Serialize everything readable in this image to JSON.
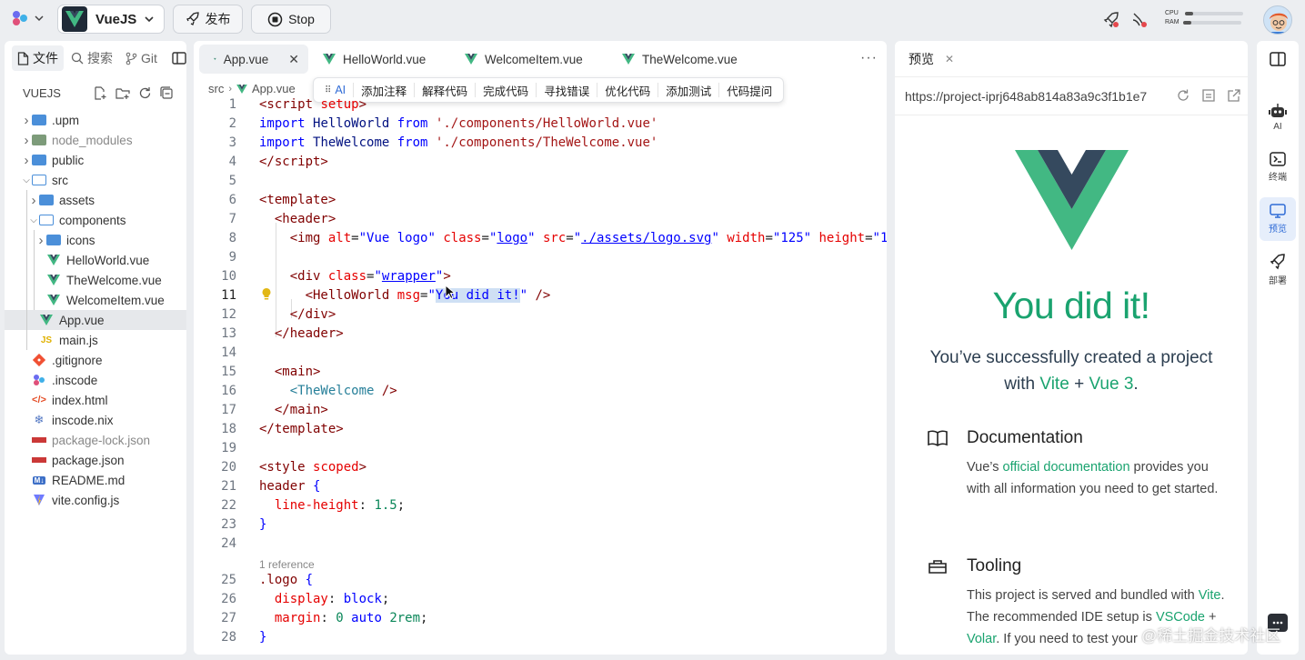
{
  "topbar": {
    "project_name": "VueJS",
    "publish_label": "发布",
    "stop_label": "Stop",
    "cpu_label": "CPU",
    "ram_label": "RAM",
    "cpu_usage": 0.14,
    "ram_usage": 0.14
  },
  "explorer": {
    "tabs": [
      "文件",
      "搜索",
      "Git"
    ],
    "root": "VUEJS",
    "items": [
      {
        "name": ".upm",
        "type": "folder"
      },
      {
        "name": "node_modules",
        "type": "folder-dim"
      },
      {
        "name": "public",
        "type": "folder"
      },
      {
        "name": "src",
        "type": "folder-open"
      },
      {
        "name": "assets",
        "type": "folder"
      },
      {
        "name": "components",
        "type": "folder-open"
      },
      {
        "name": "icons",
        "type": "folder"
      },
      {
        "name": "HelloWorld.vue",
        "type": "vue"
      },
      {
        "name": "TheWelcome.vue",
        "type": "vue"
      },
      {
        "name": "WelcomeItem.vue",
        "type": "vue"
      },
      {
        "name": "App.vue",
        "type": "vue"
      },
      {
        "name": "main.js",
        "type": "js"
      },
      {
        "name": ".gitignore",
        "type": "git"
      },
      {
        "name": ".inscode",
        "type": "inscode"
      },
      {
        "name": "index.html",
        "type": "html"
      },
      {
        "name": "inscode.nix",
        "type": "nix"
      },
      {
        "name": "package-lock.json",
        "type": "npm"
      },
      {
        "name": "package.json",
        "type": "npm"
      },
      {
        "name": "README.md",
        "type": "md"
      },
      {
        "name": "vite.config.js",
        "type": "vite"
      }
    ]
  },
  "editor": {
    "tabs": [
      "App.vue",
      "HelloWorld.vue",
      "WelcomeItem.vue",
      "TheWelcome.vue"
    ],
    "breadcrumb": [
      "src",
      "App.vue"
    ],
    "ai_toolbar": [
      "AI",
      "添加注释",
      "解释代码",
      "完成代码",
      "寻找错误",
      "优化代码",
      "添加测试",
      "代码提问"
    ],
    "reference_hint": "1 reference",
    "line_numbers": [
      "1",
      "2",
      "3",
      "4",
      "5",
      "6",
      "7",
      "8",
      "9",
      "10",
      "11",
      "12",
      "13",
      "14",
      "15",
      "16",
      "17",
      "18",
      "19",
      "20",
      "21",
      "22",
      "23",
      "24",
      "25",
      "26",
      "27",
      "28"
    ]
  },
  "preview": {
    "title": "预览",
    "url": "https://project-iprj648ab814a83a9c3f1b1e7",
    "headline": "You did it!",
    "subtitle_1": "You’ve successfully created a project",
    "subtitle_with": "with",
    "subtitle_vite": "Vite",
    "subtitle_plus": "+",
    "subtitle_vue": "Vue 3",
    "subtitle_end": ".",
    "doc_title": "Documentation",
    "doc_text_1": "Vue’s",
    "doc_link": "official documentation",
    "doc_text_2": "provides you with all information you need to get started.",
    "tool_title": "Tooling",
    "tool_text_1": "This project is served and bundled with",
    "tool_link_vite": "Vite",
    "tool_text_2": ". The recommended IDE setup is",
    "tool_link_vscode": "VSCode",
    "tool_plus": "+",
    "tool_link_volar": "Volar",
    "tool_text_3": ". If you need to test your"
  },
  "rail": {
    "ai": "AI",
    "terminal": "终端",
    "preview": "预览",
    "deploy": "部署"
  },
  "watermark": "@稀土掘金技术社区",
  "colors": {
    "vue_green": "#1aa36f",
    "vue_dark": "#34495e",
    "accent": "#2f6bd6"
  }
}
